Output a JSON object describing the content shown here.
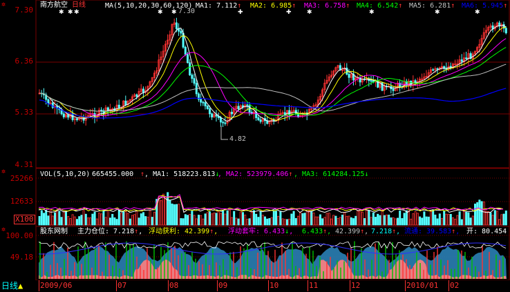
{
  "colors": {
    "up": "#ff3232",
    "down": "#54ffff",
    "grid": "#7a0000",
    "bg": "#000000",
    "ma1": "#ffffff",
    "ma2": "#ffff00",
    "ma3": "#ff00ff",
    "ma4": "#00ff00",
    "ma5": "#c0c0c0",
    "ma6": "#0000ff"
  },
  "main": {
    "stock_name": "南方航空",
    "period": "日线",
    "ma_params": "MA(5,10,20,30,60,120)",
    "ma1": {
      "label": "MA1:",
      "value": "7.112"
    },
    "ma2": {
      "label": "MA2:",
      "value": "6.985"
    },
    "ma3": {
      "label": "MA3:",
      "value": "6.758"
    },
    "ma4": {
      "label": "MA4:",
      "value": "6.542"
    },
    "ma5": {
      "label": "MA5:",
      "value": "6.281"
    },
    "ma6": {
      "label": "MA6:",
      "value": "5.945"
    },
    "y_labels": [
      "7.30",
      "6.36",
      "5.33",
      "4.31"
    ],
    "high_mark": "7.30",
    "low_mark": "4.82"
  },
  "vol": {
    "title": "VOL(5,10,20)",
    "value": "665455.000",
    "ma1": "MA1: 518223.813",
    "ma2": "MA2: 523979.406",
    "ma3": "MA3: 614284.125",
    "y_labels": [
      "25266",
      "12633"
    ],
    "unit": "X100"
  },
  "ind": {
    "title": "股东网制",
    "main_pos": "主力仓位: 7.218",
    "float_profit": "浮动获利: 42.399",
    "float_trap": "浮动套牢: 6.433",
    "v4": "6.433",
    "v5": "42.399",
    "v6": "7.218",
    "v7": "流通: 39.583",
    "open": "开: 80.454",
    "y_labels": [
      "100.00",
      "49.18"
    ]
  },
  "bottom": {
    "period": "日线",
    "dates": [
      "2009/06",
      "07",
      "08",
      "09",
      "10",
      "11",
      "12",
      "2010/01",
      "02"
    ]
  }
}
